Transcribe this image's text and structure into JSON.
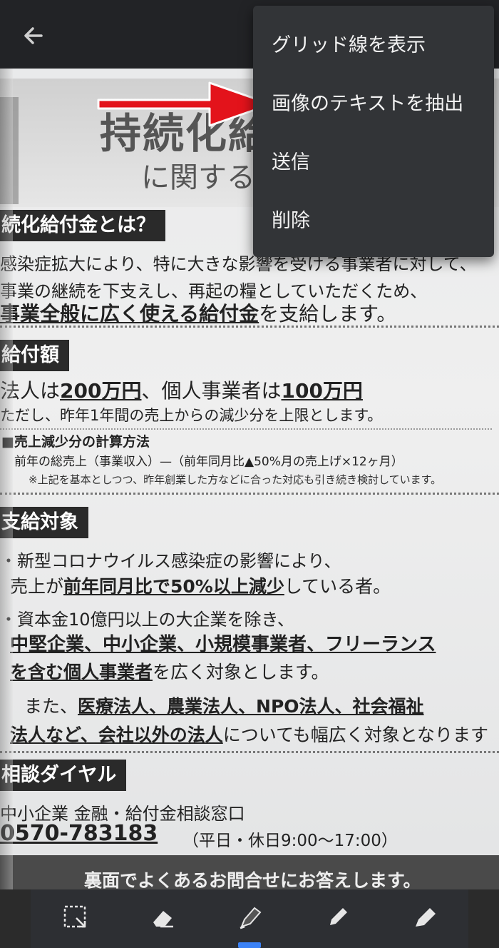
{
  "toolbar_top": {
    "back_icon": "arrow-left-icon"
  },
  "menu": {
    "items": [
      {
        "label": "グリッド線を表示"
      },
      {
        "label": "画像のテキストを抽出"
      },
      {
        "label": "送信"
      },
      {
        "label": "削除"
      }
    ]
  },
  "document": {
    "title_partial": "持続化給",
    "subtitle_partial": "に関するお",
    "section1": {
      "heading": "続化給付金とは？",
      "line1": "感染症拡大により、特に大きな影響を受ける事業者に対して、",
      "line2": "事業の継続を下支えし、再起の糧としていただくため、",
      "line3_bold": "事業全般に広く使える給付金",
      "line3_rest": "を支給します。"
    },
    "section2": {
      "heading": "給付額",
      "line1_a": "法人は",
      "line1_b": "200万円",
      "line1_c": "、個人事業者は",
      "line1_d": "100万円",
      "line2": "ただし、昨年1年間の売上からの減少分を上限とします。",
      "calc_heading": "■売上減少分の計算方法",
      "calc_formula": "前年の総売上（事業収入）—（前年同月比▲50%月の売上げ×12ヶ月）",
      "calc_note": "※上記を基本としつつ、昨年創業した方などに合った対応も引き続き検討しています。"
    },
    "section3": {
      "heading": "支給対象",
      "line1": "・新型コロナウイルス感染症の影響により、",
      "line2_a": "売上が",
      "line2_b": "前年同月比で50%以上減少",
      "line2_c": "している者。",
      "line3": "・資本金10億円以上の大企業を除き、",
      "line4_bold": "中堅企業、中小企業、小規模事業者、フリーランス",
      "line5_bold": "を含む個人事業者",
      "line5_rest": "を広く対象とします。",
      "line6_a": "また、",
      "line6_bold": "医療法人、農業法人、NPO法人、社会福祉",
      "line7_bold": "法人など、会社以外の法人",
      "line7_rest": "についても幅広く対象となります"
    },
    "section4": {
      "heading": "相談ダイヤル",
      "line1": "中小企業 金融・給付金相談窓口",
      "phone": "0570-783183",
      "hours": "（平日・休日9:00〜17:00）"
    },
    "footer": "裏面でよくあるお問合せにお答えします。"
  },
  "bottom_toolbar": {
    "tools": [
      "crop-select-icon",
      "eraser-icon",
      "marker-icon",
      "pen-icon",
      "highlighter-icon"
    ],
    "active_tool": "marker-icon"
  },
  "colors": {
    "menu_bg": "#323437",
    "arrow": "#e3131b",
    "active": "#3b82f6"
  }
}
